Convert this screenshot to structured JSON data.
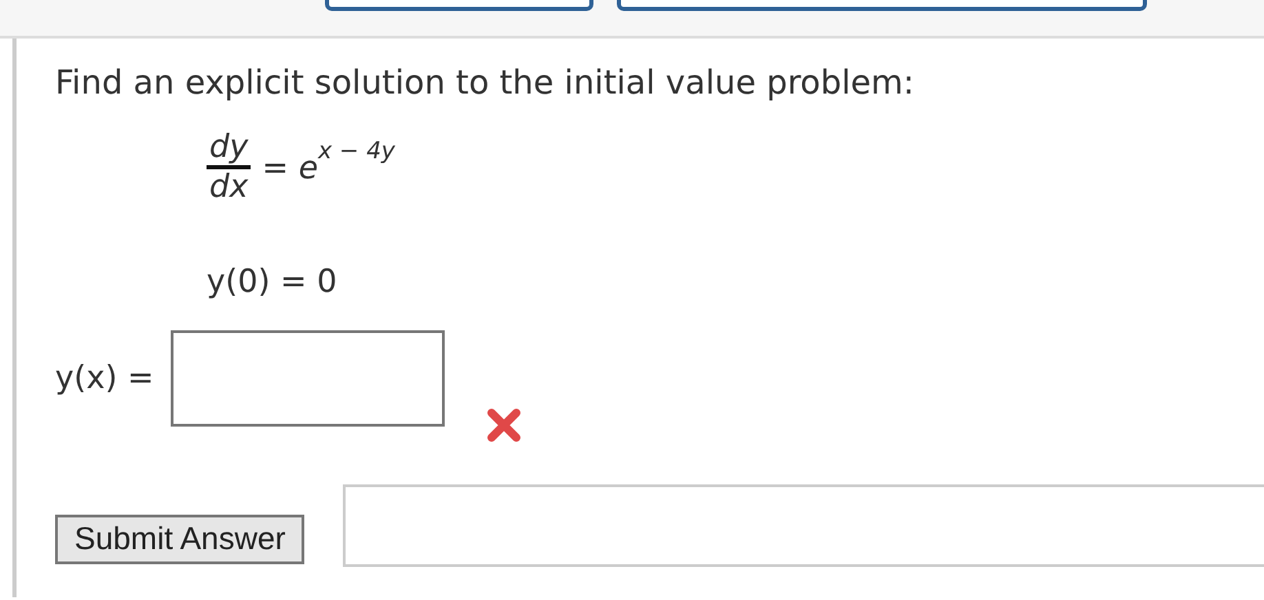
{
  "prompt": "Find an explicit solution to the initial value problem:",
  "equation": {
    "numerator": "dy",
    "denominator": "dx",
    "relation": "=",
    "base": "e",
    "exponent": "x − 4y"
  },
  "initial_condition": "y(0) = 0",
  "answer": {
    "label": "y(x) =",
    "correct": false
  },
  "submit_button": "Submit Answer"
}
